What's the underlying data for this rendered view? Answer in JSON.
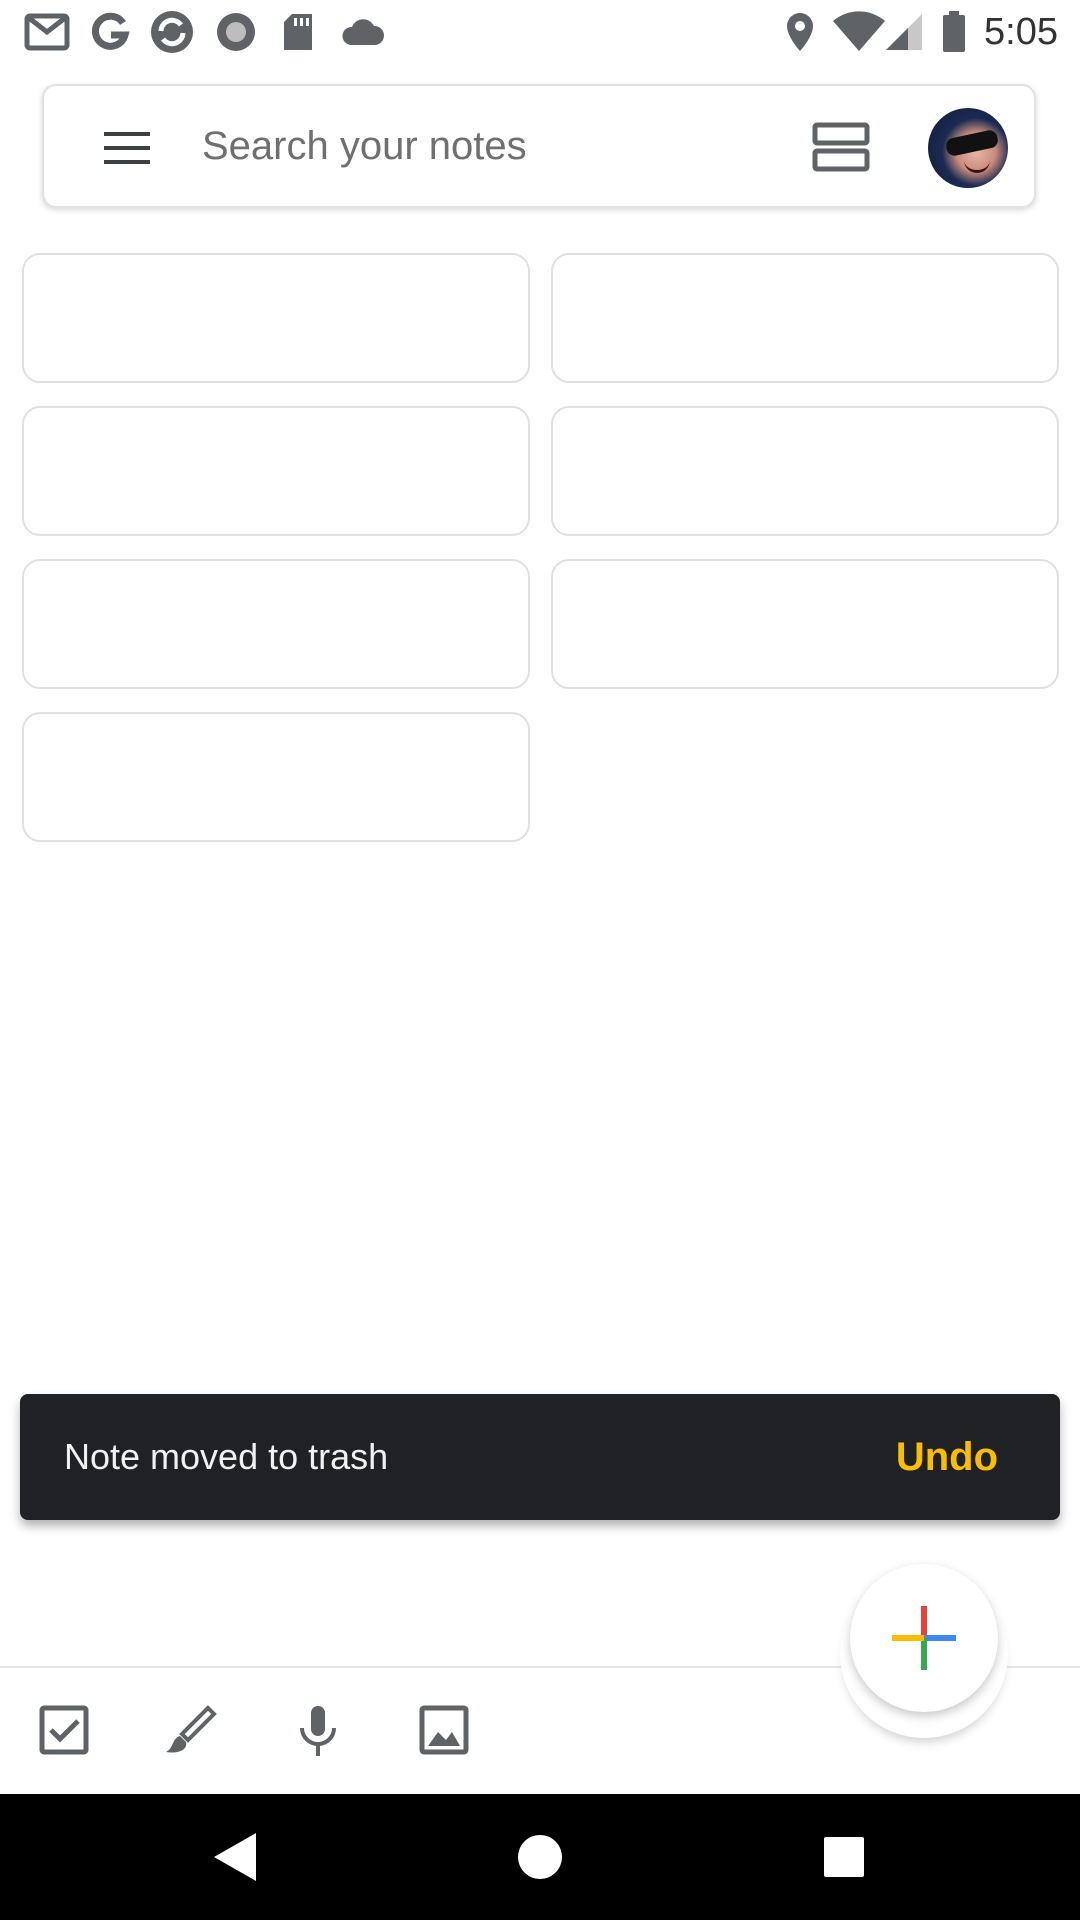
{
  "status_bar": {
    "time": "5:05",
    "left_icons": [
      "gmail-icon",
      "google-icon",
      "sync-icon",
      "record-icon",
      "sd-card-icon",
      "cloud-icon"
    ],
    "right_icons": [
      "location-icon",
      "wifi-icon",
      "signal-icon",
      "battery-icon"
    ]
  },
  "search": {
    "placeholder": "Search your notes"
  },
  "notes": {
    "count": 7
  },
  "snackbar": {
    "message": "Note moved to trash",
    "action": "Undo",
    "action_color": "#fbbc04"
  },
  "bottom_bar": {
    "icons": [
      "checkbox-icon",
      "brush-icon",
      "microphone-icon",
      "image-icon"
    ]
  },
  "fab": {
    "icon": "plus-icon",
    "colors": [
      "#ea4335",
      "#4285f4",
      "#34a853",
      "#fbbc04"
    ]
  },
  "nav_bar": {
    "buttons": [
      "back-icon",
      "home-icon",
      "recents-icon"
    ]
  }
}
